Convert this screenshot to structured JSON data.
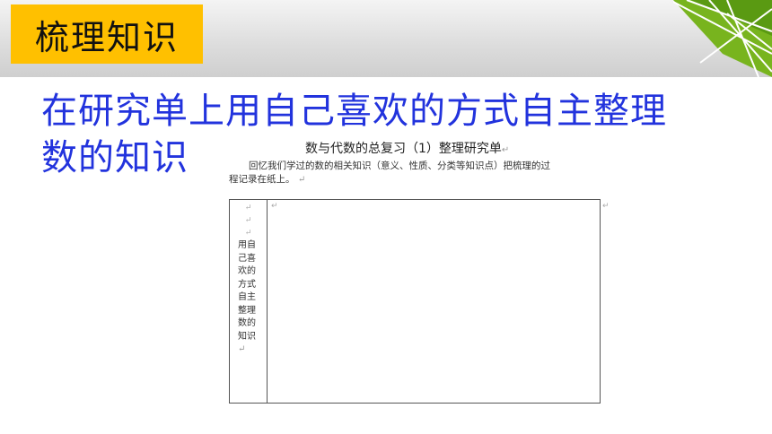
{
  "slide": {
    "tag_label": "梳理知识",
    "headline_line1": "在研究单上用自己喜欢的方式自主整理",
    "headline_line2": "数的知识",
    "colors": {
      "tag_bg": "#ffc000",
      "headline": "#2233dd",
      "deco_green": "#78b41e"
    }
  },
  "worksheet": {
    "title": "数与代数的总复习（1）整理研究单",
    "intro_line1": "回忆我们学过的数的相关知识（意义、性质、分类等知识点）把梳理的过",
    "intro_line2": "程记录在纸上。",
    "paragraph_mark": "↵",
    "left_cell_text": "用自己喜欢的方式自主整理数的知识"
  }
}
